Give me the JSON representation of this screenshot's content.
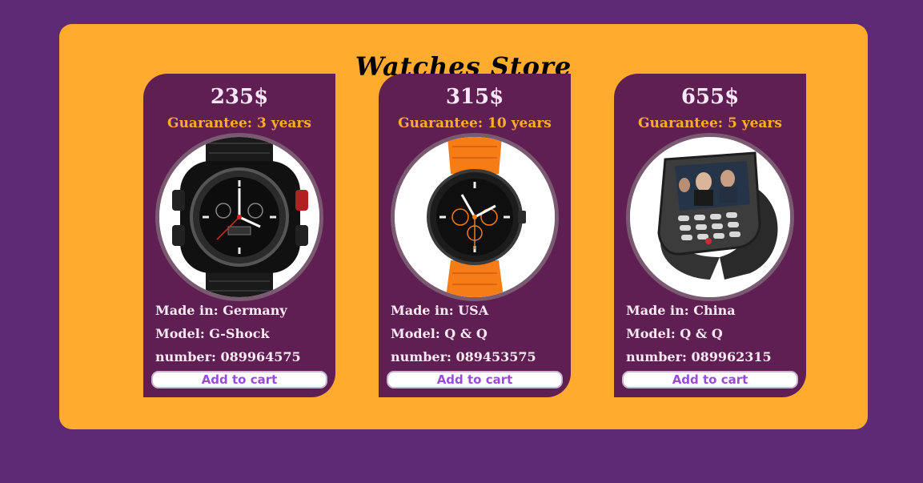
{
  "store": {
    "title": "Watches Store"
  },
  "products": [
    {
      "price": "235$",
      "guarantee": "Guarantee: 3 years",
      "made_in": "Made in: Germany",
      "model": "Model: G-Shock",
      "number": "number: 089964575",
      "button_label": "Add to cart",
      "image": "g-shock-watch"
    },
    {
      "price": "315$",
      "guarantee": "Guarantee: 10 years",
      "made_in": "Made in: USA",
      "model": "Model: Q & Q",
      "number": "number: 089453575",
      "button_label": "Add to cart",
      "image": "orange-strap-chronograph-watch"
    },
    {
      "price": "655$",
      "guarantee": "Guarantee: 5 years",
      "made_in": "Made in: China",
      "model": "Model: Q & Q",
      "number": "number: 089962315",
      "button_label": "Add to cart",
      "image": "phone-watch"
    }
  ],
  "colors": {
    "page_background": "#5e2a75",
    "panel_background": "#ffab2e",
    "card_background": "#5f1f53",
    "guarantee_text": "#ffab2e",
    "button_text": "#9a4cd8"
  }
}
